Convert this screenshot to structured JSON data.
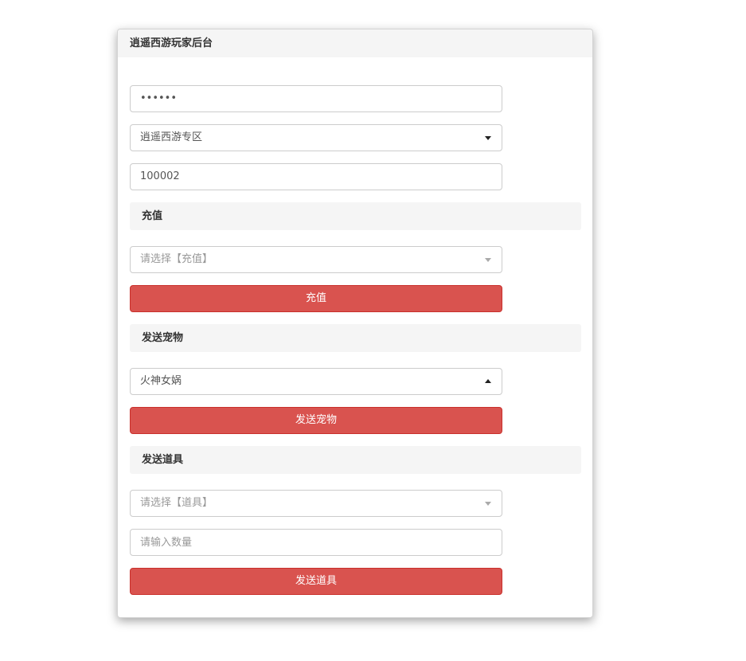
{
  "panel": {
    "title": "逍遥西游玩家后台"
  },
  "login": {
    "password_value": "••••••",
    "server_select_value": "逍遥西游专区",
    "player_id_value": "100002"
  },
  "recharge": {
    "section_title": "充值",
    "select_placeholder": "请选择【充值】",
    "button_label": "充值"
  },
  "pet": {
    "section_title": "发送宠物",
    "select_value": "火神女娲",
    "button_label": "发送宠物"
  },
  "item": {
    "section_title": "发送道具",
    "select_placeholder": "请选择【道具】",
    "quantity_placeholder": "请输入数量",
    "button_label": "发送道具"
  },
  "colors": {
    "danger_button": "#d9534f",
    "section_bg": "#f5f5f5"
  }
}
